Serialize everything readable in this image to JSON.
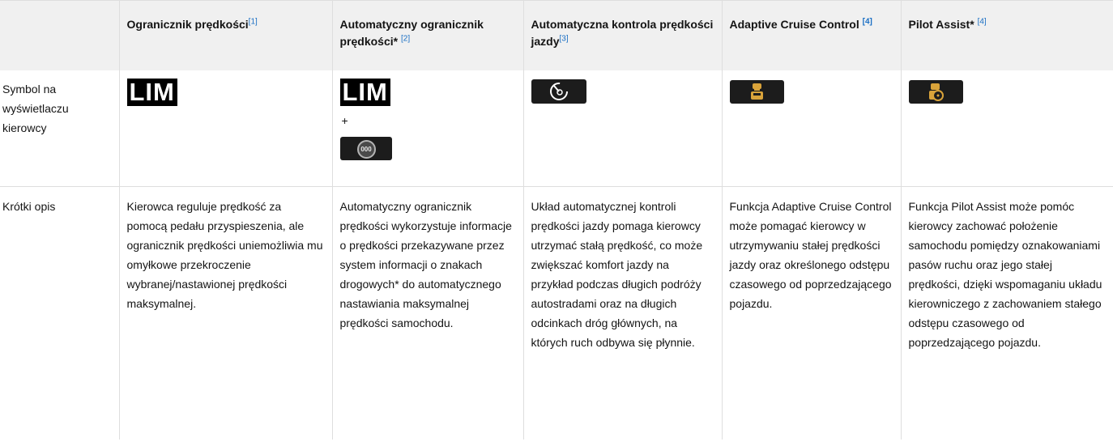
{
  "header": {
    "col1": {
      "title": "Ogranicznik prędkości",
      "ref": "[1]"
    },
    "col2": {
      "title": "Automatyczny ogranicznik prędkości*",
      "ref": "[2]"
    },
    "col3": {
      "title": "Automatyczna kontrola prędkości jazdy",
      "ref": "[3]"
    },
    "col4": {
      "title": "Adaptive Cruise Control",
      "ref": "[4]"
    },
    "col5": {
      "title": "Pilot Assist*",
      "ref": "[4]"
    }
  },
  "row_symbol": {
    "label": "Symbol na wyświetlaczu kierowcy",
    "lim1": "LIM",
    "lim2": "LIM",
    "plus": "+",
    "badge_000": "000",
    "icons": {
      "speed_limiter_icon": "lim-text",
      "auto_limiter_icon": "speedometer-000-icon",
      "cruise_control_icon": "speedometer-icon",
      "acc_icon": "car-following-icon",
      "pilot_assist_icon": "steering-wheel-car-icon"
    },
    "colors": {
      "icon_bg": "#1c1c1c",
      "icon_accent": "#d9a33a",
      "link": "#1a6fc4"
    }
  },
  "row_description": {
    "label": "Krótki opis",
    "col1": "Kierowca reguluje prędkość za pomocą pedału przyspieszenia, ale ogranicznik prędkości uniemożliwia mu omyłkowe przekroczenie wybranej/nastawionej prędkości maksymalnej.",
    "col2": "Automatyczny ogranicznik prędkości wykorzystuje informacje o prędkości przekazywane przez system informacji o znakach drogowych* do automatycznego nastawiania maksymalnej prędkości samochodu.",
    "col3": "Układ automatycznej kontroli prędkości jazdy pomaga kierowcy utrzymać stałą prędkość, co może zwiększać komfort jazdy na przykład podczas długich podróży autostradami oraz na długich odcinkach dróg głównych, na których ruch odbywa się płynnie.",
    "col4": "Funkcja Adaptive Cruise Control może pomagać kierowcy w utrzymywaniu stałej prędkości jazdy oraz określonego odstępu czasowego od poprzedzającego pojazdu.",
    "col5": "Funkcja Pilot Assist może pomóc kierowcy zachować położenie samochodu pomiędzy oznakowaniami pasów ruchu oraz jego stałej prędkości, dzięki wspomaganiu układu kierowniczego z zachowaniem stałego odstępu czasowego od poprzedzającego pojazdu."
  }
}
